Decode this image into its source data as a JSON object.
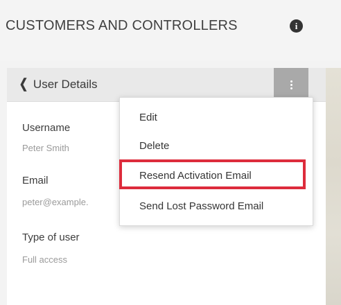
{
  "header": {
    "title": "CUSTOMERS AND CONTROLLERS",
    "info_icon": "info-icon",
    "info_glyph": "i"
  },
  "panel": {
    "back_label": "User Details",
    "back_icon": "chevron-left-icon",
    "menu_icon": "kebab-menu-icon",
    "fields": [
      {
        "label": "Username",
        "value": "Peter Smith"
      },
      {
        "label": "Email",
        "value": "peter@example."
      },
      {
        "label": "Type of user",
        "value": "Full access"
      }
    ]
  },
  "menu": {
    "items": [
      {
        "label": "Edit"
      },
      {
        "label": "Delete"
      },
      {
        "label": "Resend Activation Email",
        "highlighted": true
      },
      {
        "label": "Send Lost Password Email"
      }
    ]
  },
  "colors": {
    "highlight": "#dd2c3c",
    "menu_button": "#a9a9a9"
  }
}
